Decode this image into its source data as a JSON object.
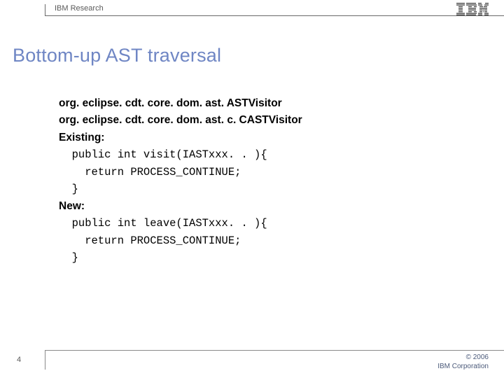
{
  "header": {
    "label": "IBM Research"
  },
  "title": "Bottom-up AST traversal",
  "content": {
    "line1": "org. eclipse. cdt. core. dom. ast. ASTVisitor",
    "line2": "org. eclipse. cdt. core. dom. ast. c. CASTVisitor",
    "existing_label": "Existing:",
    "existing_code_l1": "  public int visit(IASTxxx. . ){",
    "existing_code_l2": "    return PROCESS_CONTINUE;",
    "existing_code_l3": "  }",
    "new_label": "New:",
    "new_code_l1": "  public int leave(IASTxxx. . ){",
    "new_code_l2": "    return PROCESS_CONTINUE;",
    "new_code_l3": "  }"
  },
  "footer": {
    "page": "4",
    "copyright_line1": "© 2006",
    "copyright_line2": "IBM Corporation"
  }
}
